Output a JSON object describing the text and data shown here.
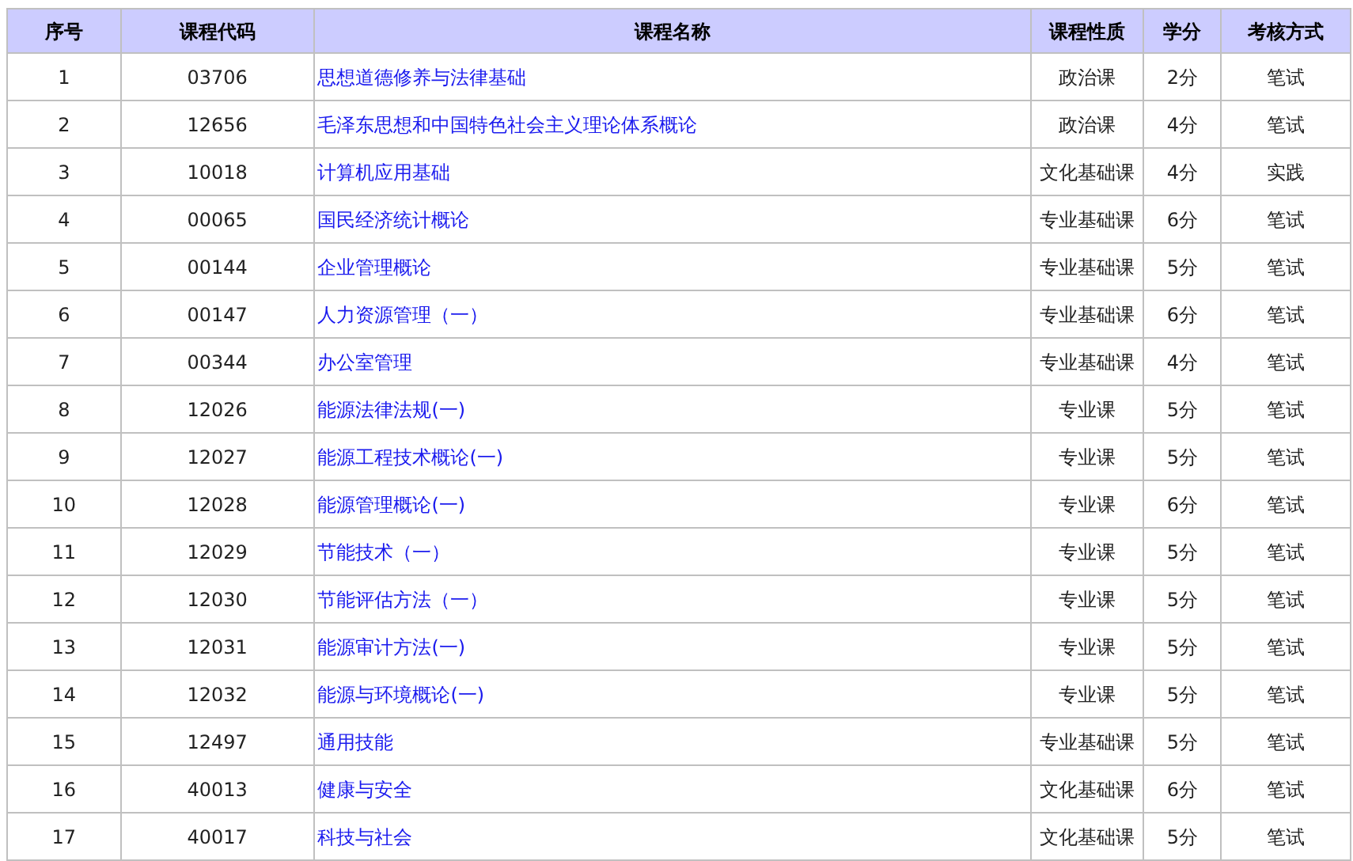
{
  "table": {
    "columns": [
      "序号",
      "课程代码",
      "课程名称",
      "课程性质",
      "学分",
      "考核方式"
    ],
    "rows": [
      {
        "no": "1",
        "code": "03706",
        "name": "思想道德修养与法律基础",
        "type": "政治课",
        "credit": "2分",
        "exam": "笔试"
      },
      {
        "no": "2",
        "code": "12656",
        "name": "毛泽东思想和中国特色社会主义理论体系概论",
        "type": "政治课",
        "credit": "4分",
        "exam": "笔试"
      },
      {
        "no": "3",
        "code": "10018",
        "name": "计算机应用基础",
        "type": "文化基础课",
        "credit": "4分",
        "exam": "实践"
      },
      {
        "no": "4",
        "code": "00065",
        "name": "国民经济统计概论",
        "type": "专业基础课",
        "credit": "6分",
        "exam": "笔试"
      },
      {
        "no": "5",
        "code": "00144",
        "name": "企业管理概论",
        "type": "专业基础课",
        "credit": "5分",
        "exam": "笔试"
      },
      {
        "no": "6",
        "code": "00147",
        "name": "人力资源管理（一）",
        "type": "专业基础课",
        "credit": "6分",
        "exam": "笔试"
      },
      {
        "no": "7",
        "code": "00344",
        "name": "办公室管理",
        "type": "专业基础课",
        "credit": "4分",
        "exam": "笔试"
      },
      {
        "no": "8",
        "code": "12026",
        "name": "能源法律法规(一)",
        "type": "专业课",
        "credit": "5分",
        "exam": "笔试"
      },
      {
        "no": "9",
        "code": "12027",
        "name": "能源工程技术概论(一)",
        "type": "专业课",
        "credit": "5分",
        "exam": "笔试"
      },
      {
        "no": "10",
        "code": "12028",
        "name": "能源管理概论(一)",
        "type": "专业课",
        "credit": "6分",
        "exam": "笔试"
      },
      {
        "no": "11",
        "code": "12029",
        "name": "节能技术（一）",
        "type": "专业课",
        "credit": "5分",
        "exam": "笔试"
      },
      {
        "no": "12",
        "code": "12030",
        "name": "节能评估方法（一）",
        "type": "专业课",
        "credit": "5分",
        "exam": "笔试"
      },
      {
        "no": "13",
        "code": "12031",
        "name": "能源审计方法(一)",
        "type": "专业课",
        "credit": "5分",
        "exam": "笔试"
      },
      {
        "no": "14",
        "code": "12032",
        "name": "能源与环境概论(一)",
        "type": "专业课",
        "credit": "5分",
        "exam": "笔试"
      },
      {
        "no": "15",
        "code": "12497",
        "name": "通用技能",
        "type": "专业基础课",
        "credit": "5分",
        "exam": "笔试"
      },
      {
        "no": "16",
        "code": "40013",
        "name": "健康与安全",
        "type": "文化基础课",
        "credit": "6分",
        "exam": "笔试"
      },
      {
        "no": "17",
        "code": "40017",
        "name": "科技与社会",
        "type": "文化基础课",
        "credit": "5分",
        "exam": "笔试"
      }
    ]
  }
}
